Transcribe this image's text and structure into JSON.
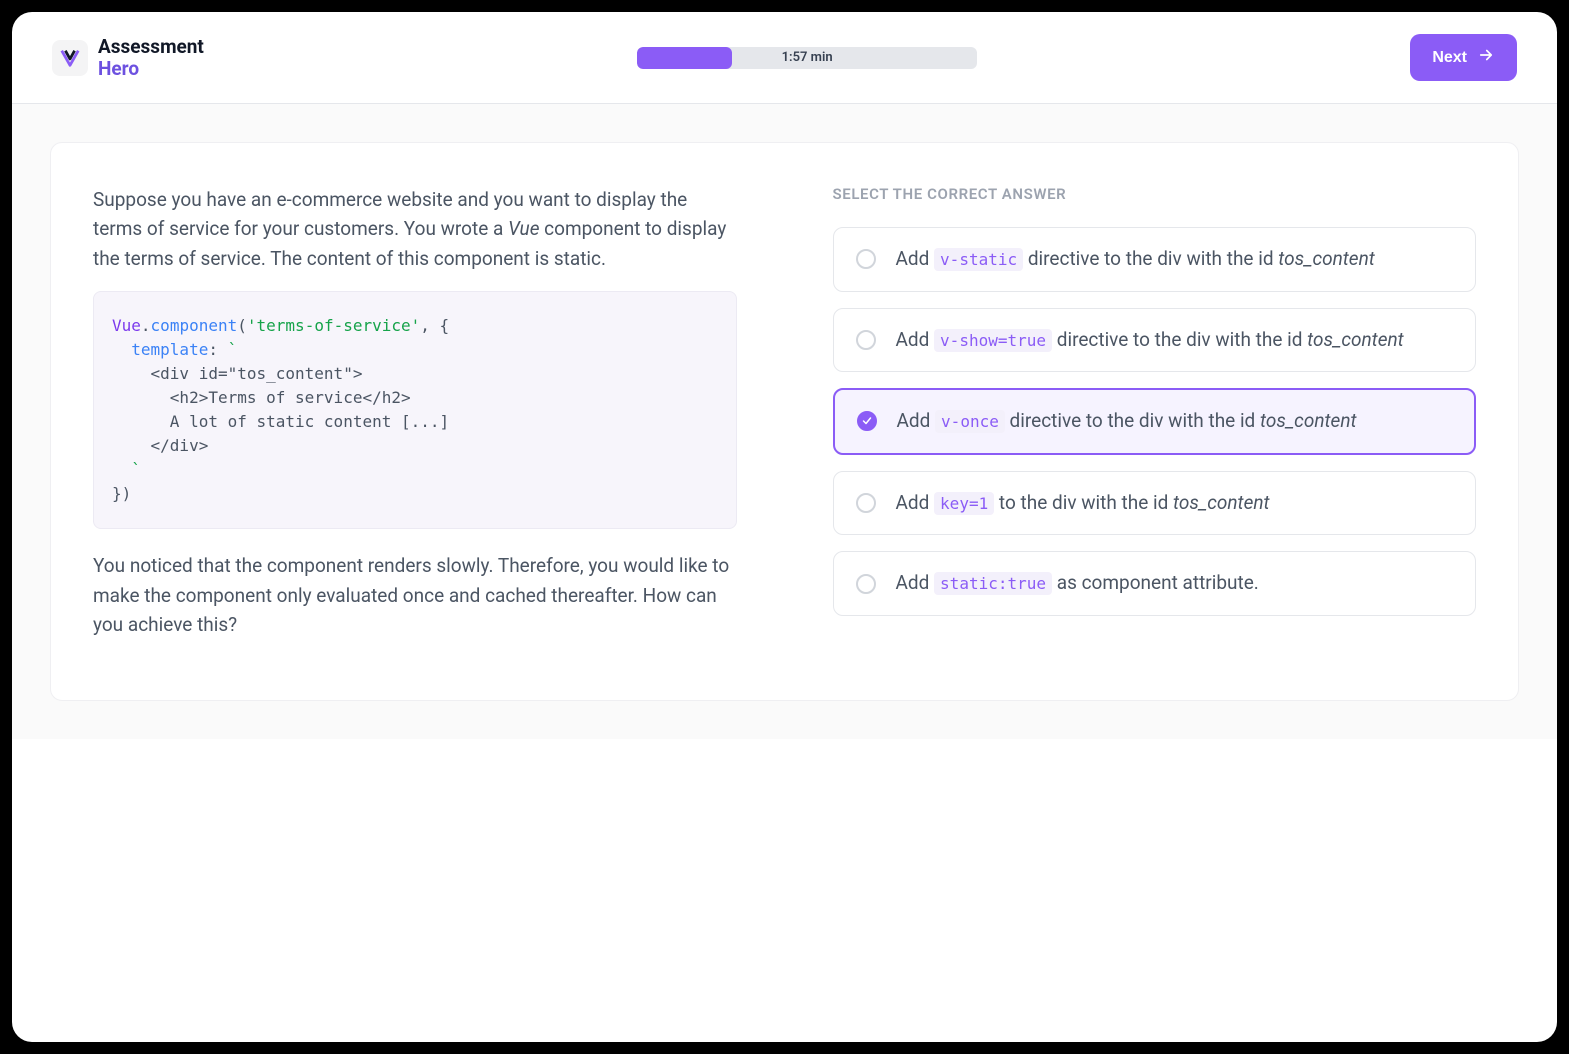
{
  "header": {
    "logo": {
      "line1": "Assessment",
      "line2": "Hero"
    },
    "timer": "1:57 min",
    "progress_pct": 28,
    "next_label": "Next"
  },
  "question": {
    "para1_before": "Suppose you have an e-commerce website and you want to display the terms of service for your customers. You wrote a ",
    "para1_em": "Vue",
    "para1_after": " component to display the terms of service. The content of this component is static.",
    "code": {
      "l1_a": "Vue",
      "l1_b": ".",
      "l1_c": "component",
      "l1_d": "(",
      "l1_e": "'terms-of-service'",
      "l1_f": ", {",
      "l2_a": "  ",
      "l2_b": "template",
      "l2_c": ":",
      "l2_d": " `",
      "l3": "    <div id=\"tos_content\">",
      "l4": "      <h2>Terms of service</h2>",
      "l5": "      A lot of static content [...]",
      "l6": "    </div>",
      "l7": "  `",
      "l8": "})"
    },
    "para2": "You noticed that the component renders slowly. Therefore, you would like to make the component only evaluated once and cached thereafter. How can you achieve this?"
  },
  "answers": {
    "title": "SELECT THE CORRECT ANSWER",
    "options": [
      {
        "prefix": "Add ",
        "code": "v-static",
        "mid": " directive to the div with the id ",
        "em": "tos_content",
        "suffix": "",
        "selected": false
      },
      {
        "prefix": "Add ",
        "code": "v-show=true",
        "mid": " directive to the div with the id ",
        "em": "tos_content",
        "suffix": "",
        "selected": false
      },
      {
        "prefix": "Add ",
        "code": "v-once",
        "mid": " directive to the div with the id ",
        "em": "tos_content",
        "suffix": "",
        "selected": true
      },
      {
        "prefix": "Add ",
        "code": "key=1",
        "mid": " to the div with the id ",
        "em": "tos_content",
        "suffix": "",
        "selected": false
      },
      {
        "prefix": "Add ",
        "code": "static:true",
        "mid": " as component attribute.",
        "em": "",
        "suffix": "",
        "selected": false
      }
    ]
  }
}
